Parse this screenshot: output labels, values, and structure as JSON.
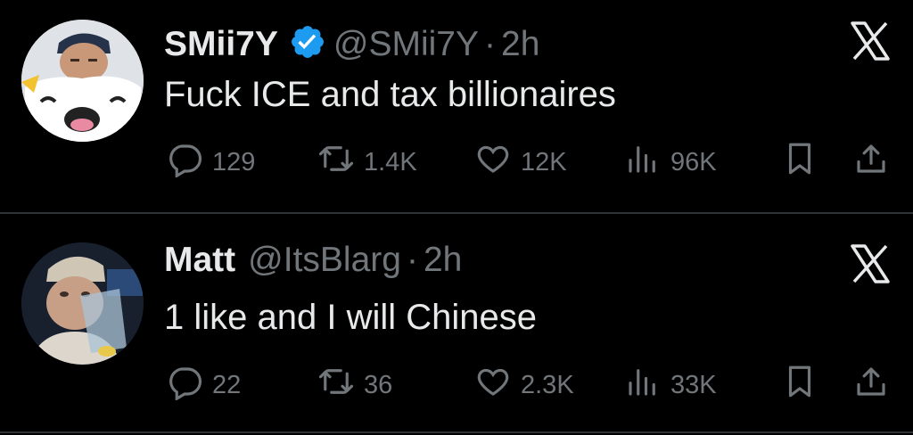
{
  "tweets": [
    {
      "name": "SMii7Y",
      "verified": true,
      "handle": "@SMii7Y",
      "separator": "·",
      "time": "2h",
      "text": "Fuck ICE and tax billionaires",
      "replies": "129",
      "retweets": "1.4K",
      "likes": "12K",
      "views": "96K"
    },
    {
      "name": "Matt",
      "verified": false,
      "handle": "@ItsBlarg",
      "separator": "·",
      "time": "2h",
      "text": "1 like and I will Chinese",
      "replies": "22",
      "retweets": "36",
      "likes": "2.3K",
      "views": "33K"
    }
  ],
  "colors": {
    "background": "#000000",
    "primary_text": "#e7e9ea",
    "secondary_text": "#71767b",
    "verified_blue": "#1d9bf0",
    "divider": "#2f3336"
  }
}
